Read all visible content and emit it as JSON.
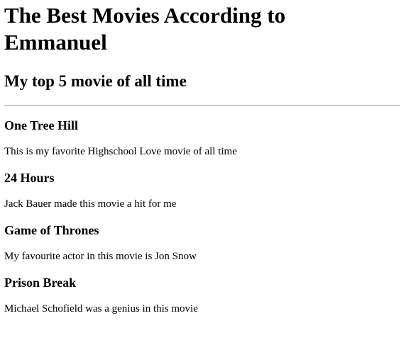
{
  "page": {
    "title": "The Best Movies According to Emmanuel",
    "subtitle": "My top 5 movie of all time"
  },
  "movies": [
    {
      "name": "One Tree Hill",
      "description": "This is my favorite Highschool Love movie of all time"
    },
    {
      "name": "24 Hours",
      "description": "Jack Bauer made this movie a hit for me"
    },
    {
      "name": "Game of Thrones",
      "description": "My favourite actor in this movie is Jon Snow"
    },
    {
      "name": "Prison Break",
      "description": "Michael Schofield was a genius in this movie"
    }
  ]
}
